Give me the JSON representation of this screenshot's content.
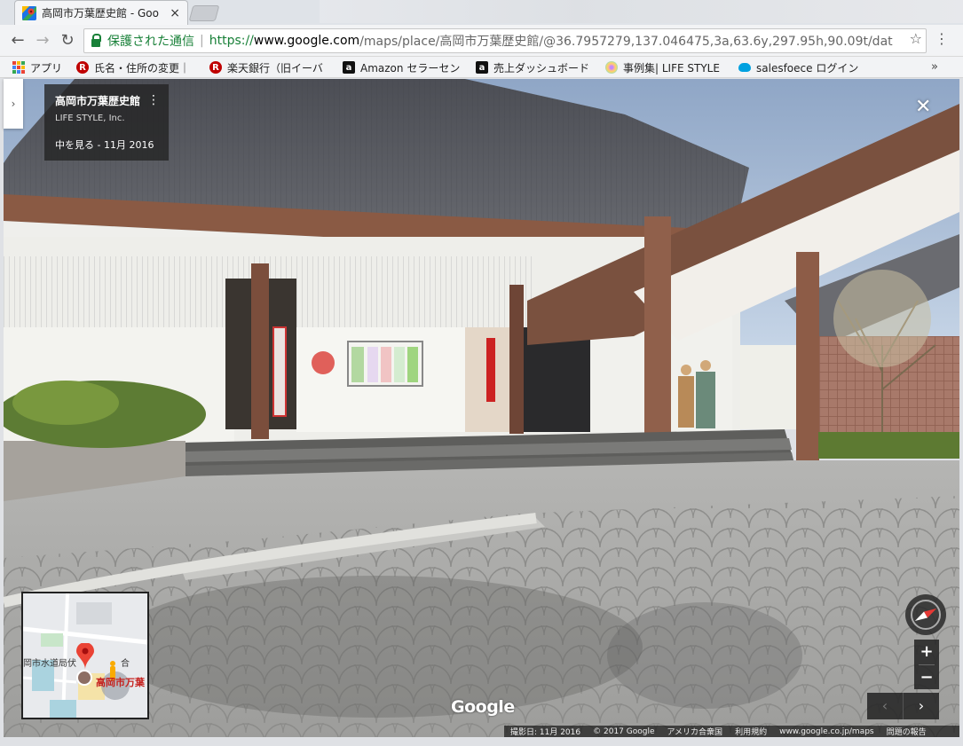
{
  "browser": {
    "tab_title": "高岡市万葉歴史館 - Goo",
    "tab_close": "×",
    "nav": {
      "back": "←",
      "forward": "→",
      "reload": "↻"
    },
    "omnibox": {
      "secure_label": "保護された通信",
      "separator": "|",
      "url_scheme": "https://",
      "url_host": "www.google.com",
      "url_path": "/maps/place/高岡市万葉歴史館/@36.7957279,137.046475,3a,63.6y,297.95h,90.09t/dat"
    },
    "star": "☆",
    "menu": "⋮",
    "bookmarks": [
      {
        "label": "アプリ",
        "icon": "apps-grid-icon"
      },
      {
        "label": "氏名・住所の変更｜",
        "icon": "rakuten-icon",
        "icon_glyph": "R",
        "color": "#bf0000"
      },
      {
        "label": "楽天銀行（旧イーバ",
        "icon": "rakuten-icon",
        "icon_glyph": "R",
        "color": "#bf0000"
      },
      {
        "label": "Amazon セラーセン",
        "icon": "amazon-icon",
        "icon_glyph": "a",
        "color": "#111111"
      },
      {
        "label": "売上ダッシュボード",
        "icon": "amazon-icon",
        "icon_glyph": "a",
        "color": "#111111"
      },
      {
        "label": "事例集| LIFE STYLE",
        "icon": "dots-icon"
      },
      {
        "label": "salesfoece ログイン",
        "icon": "cloud-icon",
        "color": "#00a1e0"
      }
    ],
    "bookmarks_more": "»"
  },
  "streetview": {
    "place_name": "高岡市万葉歴史館",
    "owner": "LIFE STYLE, Inc.",
    "date_label": "中を見る - 11月 2016",
    "kebab": "⋮",
    "close": "✕",
    "side_toggle": "›",
    "minimap": {
      "label_left": "岡市水道局伏",
      "label_right": "合",
      "place_label": "高岡市万葉"
    },
    "zoom_in": "+",
    "zoom_out": "−",
    "prev": "‹",
    "next": "›",
    "google_logo": "Google",
    "footer": {
      "capture": "撮影日: 11月 2016",
      "copyright": "© 2017 Google",
      "region": "アメリカ合衆国",
      "terms": "利用規約",
      "domain": "www.google.co.jp/maps",
      "report": "問題の報告"
    }
  }
}
